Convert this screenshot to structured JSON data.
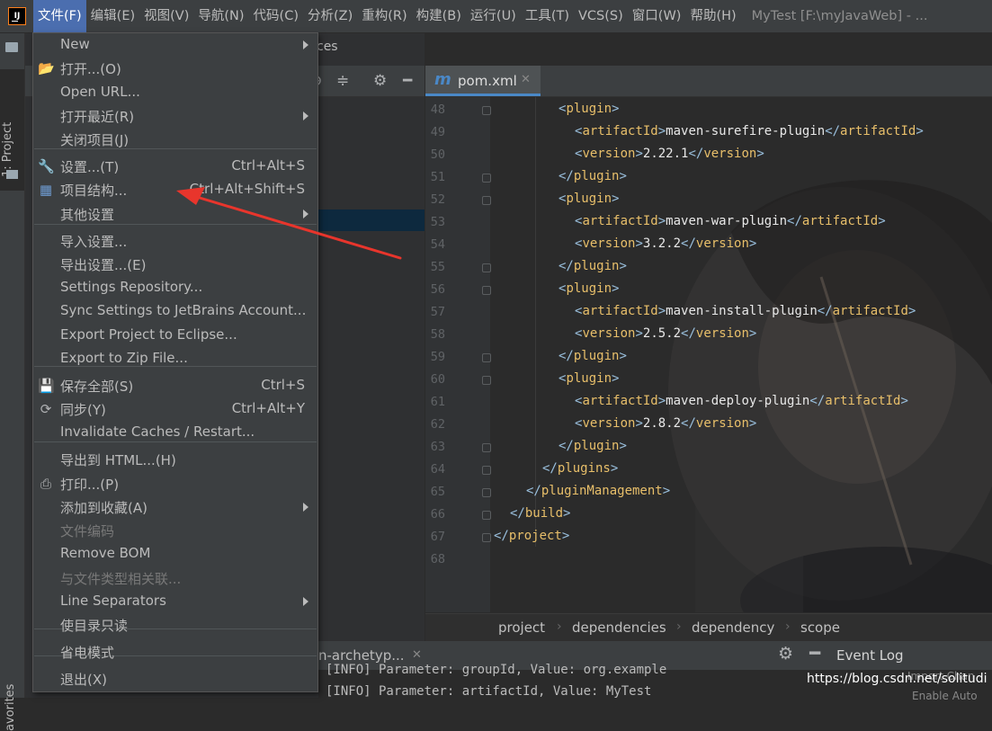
{
  "menubar": {
    "items": [
      "文件(F)",
      "编辑(E)",
      "视图(V)",
      "导航(N)",
      "代码(C)",
      "分析(Z)",
      "重构(R)",
      "构建(B)",
      "运行(U)",
      "工具(T)",
      "VCS(S)",
      "窗口(W)",
      "帮助(H)"
    ],
    "active_index": 0,
    "window_title": "MyTest [F:\\myJavaWeb] - ..."
  },
  "left_strip": {
    "project_tab": "1: Project",
    "favorites_tab": "avorites"
  },
  "project_panel": {
    "header_fragment": "ces"
  },
  "file_menu": {
    "items": [
      {
        "label": "New",
        "shortcut": "",
        "submenu": true,
        "icon": ""
      },
      {
        "label": "打开...(O)",
        "shortcut": "",
        "submenu": false,
        "icon": "folder-open-icon"
      },
      {
        "label": "Open URL...",
        "shortcut": "",
        "submenu": false,
        "icon": ""
      },
      {
        "label": "打开最近(R)",
        "shortcut": "",
        "submenu": true,
        "icon": ""
      },
      {
        "label": "关闭项目(J)",
        "shortcut": "",
        "submenu": false,
        "icon": ""
      },
      {
        "label": "设置...(T)",
        "shortcut": "Ctrl+Alt+S",
        "submenu": false,
        "icon": "wrench-icon"
      },
      {
        "label": "项目结构...",
        "shortcut": "Ctrl+Alt+Shift+S",
        "submenu": false,
        "icon": "project-structure-icon"
      },
      {
        "label": "其他设置",
        "shortcut": "",
        "submenu": true,
        "icon": ""
      },
      {
        "label": "导入设置...",
        "shortcut": "",
        "submenu": false,
        "icon": ""
      },
      {
        "label": "导出设置...(E)",
        "shortcut": "",
        "submenu": false,
        "icon": ""
      },
      {
        "label": "Settings Repository...",
        "shortcut": "",
        "submenu": false,
        "icon": ""
      },
      {
        "label": "Sync Settings to JetBrains Account...",
        "shortcut": "",
        "submenu": false,
        "icon": ""
      },
      {
        "label": "Export Project to Eclipse...",
        "shortcut": "",
        "submenu": false,
        "icon": ""
      },
      {
        "label": "Export to Zip File...",
        "shortcut": "",
        "submenu": false,
        "icon": ""
      },
      {
        "label": "保存全部(S)",
        "shortcut": "Ctrl+S",
        "submenu": false,
        "icon": "save-icon"
      },
      {
        "label": "同步(Y)",
        "shortcut": "Ctrl+Alt+Y",
        "submenu": false,
        "icon": "sync-icon"
      },
      {
        "label": "Invalidate Caches / Restart...",
        "shortcut": "",
        "submenu": false,
        "icon": ""
      },
      {
        "label": "导出到 HTML...(H)",
        "shortcut": "",
        "submenu": false,
        "icon": ""
      },
      {
        "label": "打印...(P)",
        "shortcut": "",
        "submenu": false,
        "icon": "print-icon"
      },
      {
        "label": "添加到收藏(A)",
        "shortcut": "",
        "submenu": true,
        "icon": ""
      },
      {
        "label": "文件编码",
        "shortcut": "",
        "submenu": false,
        "icon": "",
        "disabled": true
      },
      {
        "label": "Remove BOM",
        "shortcut": "",
        "submenu": false,
        "icon": ""
      },
      {
        "label": "与文件类型相关联...",
        "shortcut": "",
        "submenu": false,
        "icon": "",
        "disabled": true
      },
      {
        "label": "Line Separators",
        "shortcut": "",
        "submenu": true,
        "icon": ""
      },
      {
        "label": "使目录只读",
        "shortcut": "",
        "submenu": false,
        "icon": ""
      },
      {
        "label": "省电模式",
        "shortcut": "",
        "submenu": false,
        "icon": ""
      },
      {
        "label": "退出(X)",
        "shortcut": "",
        "submenu": false,
        "icon": ""
      }
    ]
  },
  "editor": {
    "tab": {
      "label": "pom.xml",
      "icon": "m"
    },
    "lines": [
      {
        "n": 48,
        "indent": 4,
        "parts": [
          [
            "br",
            "<"
          ],
          [
            "tg",
            "plugin"
          ],
          [
            "br",
            ">"
          ]
        ]
      },
      {
        "n": 49,
        "indent": 5,
        "parts": [
          [
            "br",
            "<"
          ],
          [
            "tg",
            "artifactId"
          ],
          [
            "br",
            ">"
          ],
          [
            "tx",
            "maven-surefire-plugin"
          ],
          [
            "br",
            "</"
          ],
          [
            "tg",
            "artifactId"
          ],
          [
            "br",
            ">"
          ]
        ]
      },
      {
        "n": 50,
        "indent": 5,
        "parts": [
          [
            "br",
            "<"
          ],
          [
            "tg",
            "version"
          ],
          [
            "br",
            ">"
          ],
          [
            "tx",
            "2.22.1"
          ],
          [
            "br",
            "</"
          ],
          [
            "tg",
            "version"
          ],
          [
            "br",
            ">"
          ]
        ]
      },
      {
        "n": 51,
        "indent": 4,
        "parts": [
          [
            "br",
            "</"
          ],
          [
            "tg",
            "plugin"
          ],
          [
            "br",
            ">"
          ]
        ]
      },
      {
        "n": 52,
        "indent": 4,
        "parts": [
          [
            "br",
            "<"
          ],
          [
            "tg",
            "plugin"
          ],
          [
            "br",
            ">"
          ]
        ]
      },
      {
        "n": 53,
        "indent": 5,
        "parts": [
          [
            "br",
            "<"
          ],
          [
            "tg",
            "artifactId"
          ],
          [
            "br",
            ">"
          ],
          [
            "tx",
            "maven-war-plugin"
          ],
          [
            "br",
            "</"
          ],
          [
            "tg",
            "artifactId"
          ],
          [
            "br",
            ">"
          ]
        ]
      },
      {
        "n": 54,
        "indent": 5,
        "parts": [
          [
            "br",
            "<"
          ],
          [
            "tg",
            "version"
          ],
          [
            "br",
            ">"
          ],
          [
            "tx",
            "3.2.2"
          ],
          [
            "br",
            "</"
          ],
          [
            "tg",
            "version"
          ],
          [
            "br",
            ">"
          ]
        ]
      },
      {
        "n": 55,
        "indent": 4,
        "parts": [
          [
            "br",
            "</"
          ],
          [
            "tg",
            "plugin"
          ],
          [
            "br",
            ">"
          ]
        ]
      },
      {
        "n": 56,
        "indent": 4,
        "parts": [
          [
            "br",
            "<"
          ],
          [
            "tg",
            "plugin"
          ],
          [
            "br",
            ">"
          ]
        ]
      },
      {
        "n": 57,
        "indent": 5,
        "parts": [
          [
            "br",
            "<"
          ],
          [
            "tg",
            "artifactId"
          ],
          [
            "br",
            ">"
          ],
          [
            "tx",
            "maven-install-plugin"
          ],
          [
            "br",
            "</"
          ],
          [
            "tg",
            "artifactId"
          ],
          [
            "br",
            ">"
          ]
        ]
      },
      {
        "n": 58,
        "indent": 5,
        "parts": [
          [
            "br",
            "<"
          ],
          [
            "tg",
            "version"
          ],
          [
            "br",
            ">"
          ],
          [
            "tx",
            "2.5.2"
          ],
          [
            "br",
            "</"
          ],
          [
            "tg",
            "version"
          ],
          [
            "br",
            ">"
          ]
        ]
      },
      {
        "n": 59,
        "indent": 4,
        "parts": [
          [
            "br",
            "</"
          ],
          [
            "tg",
            "plugin"
          ],
          [
            "br",
            ">"
          ]
        ]
      },
      {
        "n": 60,
        "indent": 4,
        "parts": [
          [
            "br",
            "<"
          ],
          [
            "tg",
            "plugin"
          ],
          [
            "br",
            ">"
          ]
        ]
      },
      {
        "n": 61,
        "indent": 5,
        "parts": [
          [
            "br",
            "<"
          ],
          [
            "tg",
            "artifactId"
          ],
          [
            "br",
            ">"
          ],
          [
            "tx",
            "maven-deploy-plugin"
          ],
          [
            "br",
            "</"
          ],
          [
            "tg",
            "artifactId"
          ],
          [
            "br",
            ">"
          ]
        ]
      },
      {
        "n": 62,
        "indent": 5,
        "parts": [
          [
            "br",
            "<"
          ],
          [
            "tg",
            "version"
          ],
          [
            "br",
            ">"
          ],
          [
            "tx",
            "2.8.2"
          ],
          [
            "br",
            "</"
          ],
          [
            "tg",
            "version"
          ],
          [
            "br",
            ">"
          ]
        ]
      },
      {
        "n": 63,
        "indent": 4,
        "parts": [
          [
            "br",
            "</"
          ],
          [
            "tg",
            "plugin"
          ],
          [
            "br",
            ">"
          ]
        ]
      },
      {
        "n": 64,
        "indent": 3,
        "parts": [
          [
            "br",
            "</"
          ],
          [
            "tg",
            "plugins"
          ],
          [
            "br",
            ">"
          ]
        ]
      },
      {
        "n": 65,
        "indent": 2,
        "parts": [
          [
            "br",
            "</"
          ],
          [
            "tg",
            "pluginManagement"
          ],
          [
            "br",
            ">"
          ]
        ]
      },
      {
        "n": 66,
        "indent": 1,
        "parts": [
          [
            "br",
            "</"
          ],
          [
            "tg",
            "build"
          ],
          [
            "br",
            ">"
          ]
        ]
      },
      {
        "n": 67,
        "indent": 0,
        "parts": [
          [
            "br",
            "</"
          ],
          [
            "tg",
            "project"
          ],
          [
            "br",
            ">"
          ]
        ]
      },
      {
        "n": 68,
        "indent": 0,
        "parts": []
      }
    ]
  },
  "breadcrumbs": [
    "project",
    "dependencies",
    "dependency",
    "scope"
  ],
  "run_panel": {
    "tab_label": "n-archetyp...",
    "event_log": "Event Log",
    "console_lines": [
      "[INFO] Parameter: groupId, Value: org.example",
      "[INFO] Parameter: artifactId, Value: MyTest"
    ],
    "watermark": "https://blog.csdn.net/solitudi",
    "import_hint": "Import Chan",
    "enable_auto": "Enable Auto"
  },
  "colors": {
    "accent": "#4b6eaf",
    "menu_bg": "#3c3f41",
    "editor_bg": "#2b2b2b",
    "xml_tag": "#e8bf6a",
    "arrow": "#e8352c"
  }
}
